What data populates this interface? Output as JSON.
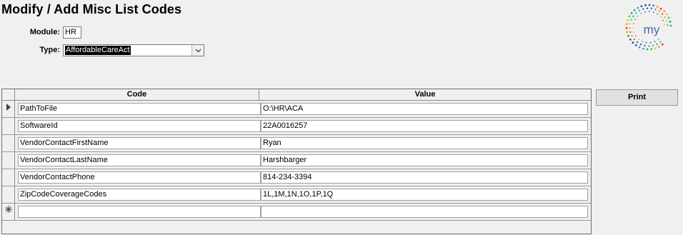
{
  "form": {
    "title": "Modify / Add Misc List Codes",
    "module_label": "Module:",
    "module_value": "HR",
    "type_label": "Type:",
    "type_value": "AffordableCareAct"
  },
  "logo": {
    "text": "my"
  },
  "grid": {
    "columns": [
      "Code",
      "Value"
    ],
    "rows": [
      {
        "code": "PathToFile",
        "value": "O:\\HR\\ACA"
      },
      {
        "code": "SoftwareId",
        "value": "22A0016257"
      },
      {
        "code": "VendorContactFirstName",
        "value": "Ryan"
      },
      {
        "code": "VendorContactLastName",
        "value": "Harshbarger"
      },
      {
        "code": "VendorContactPhone",
        "value": "814-234-3394"
      },
      {
        "code": "ZipCodeCoverageCodes",
        "value": "1L,1M,1N,1O,1P,1Q"
      }
    ],
    "new_row": {
      "code": "",
      "value": ""
    }
  },
  "toolbar": {
    "print_label": "Print"
  },
  "icons": {
    "current_row": "record-pointer-icon",
    "new_row": "new-record-asterisk-icon",
    "dropdown": "chevron-down-icon"
  }
}
